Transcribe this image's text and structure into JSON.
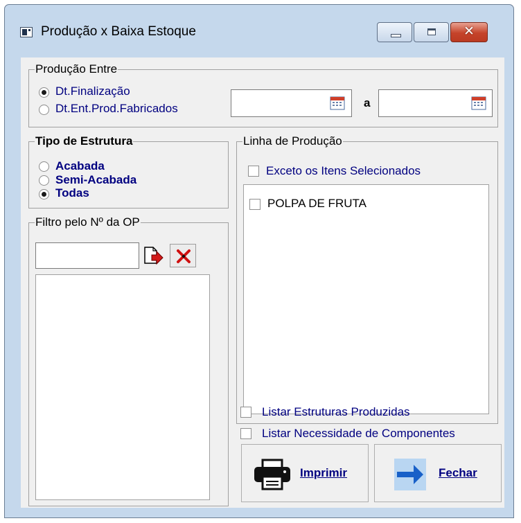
{
  "window": {
    "title": "Produção x Baixa Estoque",
    "close_glyph": "✕"
  },
  "producao_entre": {
    "label": "Produção Entre",
    "options": [
      {
        "label": "Dt.Finalização",
        "checked": true
      },
      {
        "label": "Dt.Ent.Prod.Fabricados",
        "checked": false
      }
    ],
    "date_from": "",
    "separator": "a",
    "date_to": ""
  },
  "tipo_estrutura": {
    "label": "Tipo de Estrutura",
    "options": [
      {
        "label": "Acabada",
        "checked": false
      },
      {
        "label": "Semi-Acabada",
        "checked": false
      },
      {
        "label": "Todas",
        "checked": true
      }
    ]
  },
  "filtro_op": {
    "label": "Filtro pelo Nº da OP",
    "input_value": ""
  },
  "linha_producao": {
    "label": "Linha de Produção",
    "exceto_label": "Exceto os Itens Selecionados",
    "items": [
      "POLPA DE FRUTA"
    ]
  },
  "options": {
    "listar_estruturas": "Listar Estruturas Produzidas",
    "listar_necessidade": "Listar Necessidade de Componentes"
  },
  "buttons": {
    "imprimir": "Imprimir",
    "fechar": "Fechar"
  },
  "colors": {
    "label_text": "#000080",
    "window_frame": "#c5d8ec",
    "client_bg": "#f0f0f0",
    "close_red": "#c5432a"
  },
  "icons": [
    "app-icon",
    "minimize-icon",
    "maximize-icon",
    "close-icon",
    "calendar-icon",
    "add-op-icon",
    "remove-op-icon",
    "printer-icon",
    "arrow-right-icon"
  ]
}
